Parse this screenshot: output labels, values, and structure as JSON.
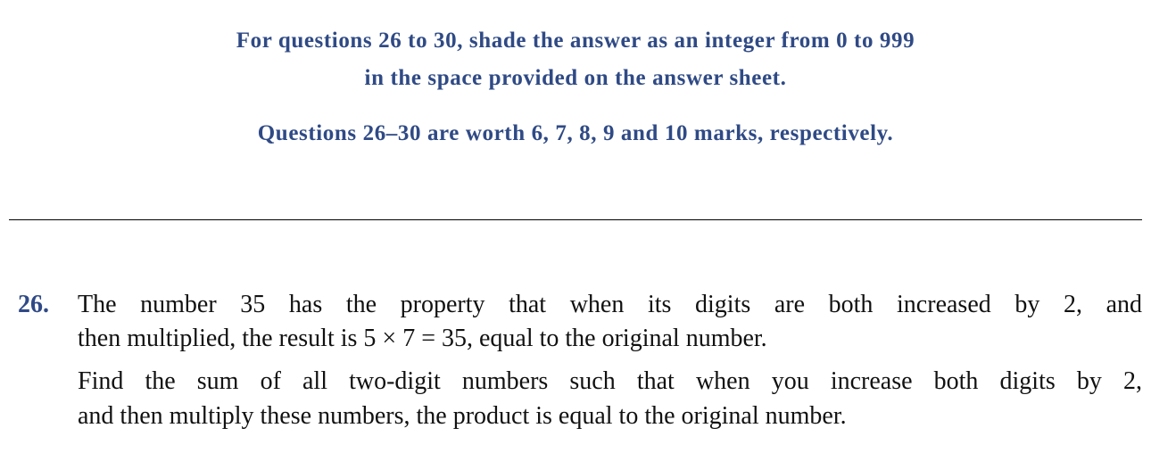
{
  "instructions": {
    "line1": "For questions 26 to 30, shade the answer as an integer from 0 to 999",
    "line2": "in the space provided on the answer sheet.",
    "marks": "Questions 26–30 are worth 6, 7, 8, 9 and 10 marks, respectively."
  },
  "question": {
    "number": "26.",
    "lines": [
      "The number 35 has the property that when its digits are both increased by 2, and",
      "then multiplied, the result is 5 × 7 = 35, equal to the original number.",
      "Find the sum of all two-digit numbers such that when you increase both digits by 2,",
      "and then multiply these numbers, the product is equal to the original number."
    ]
  }
}
